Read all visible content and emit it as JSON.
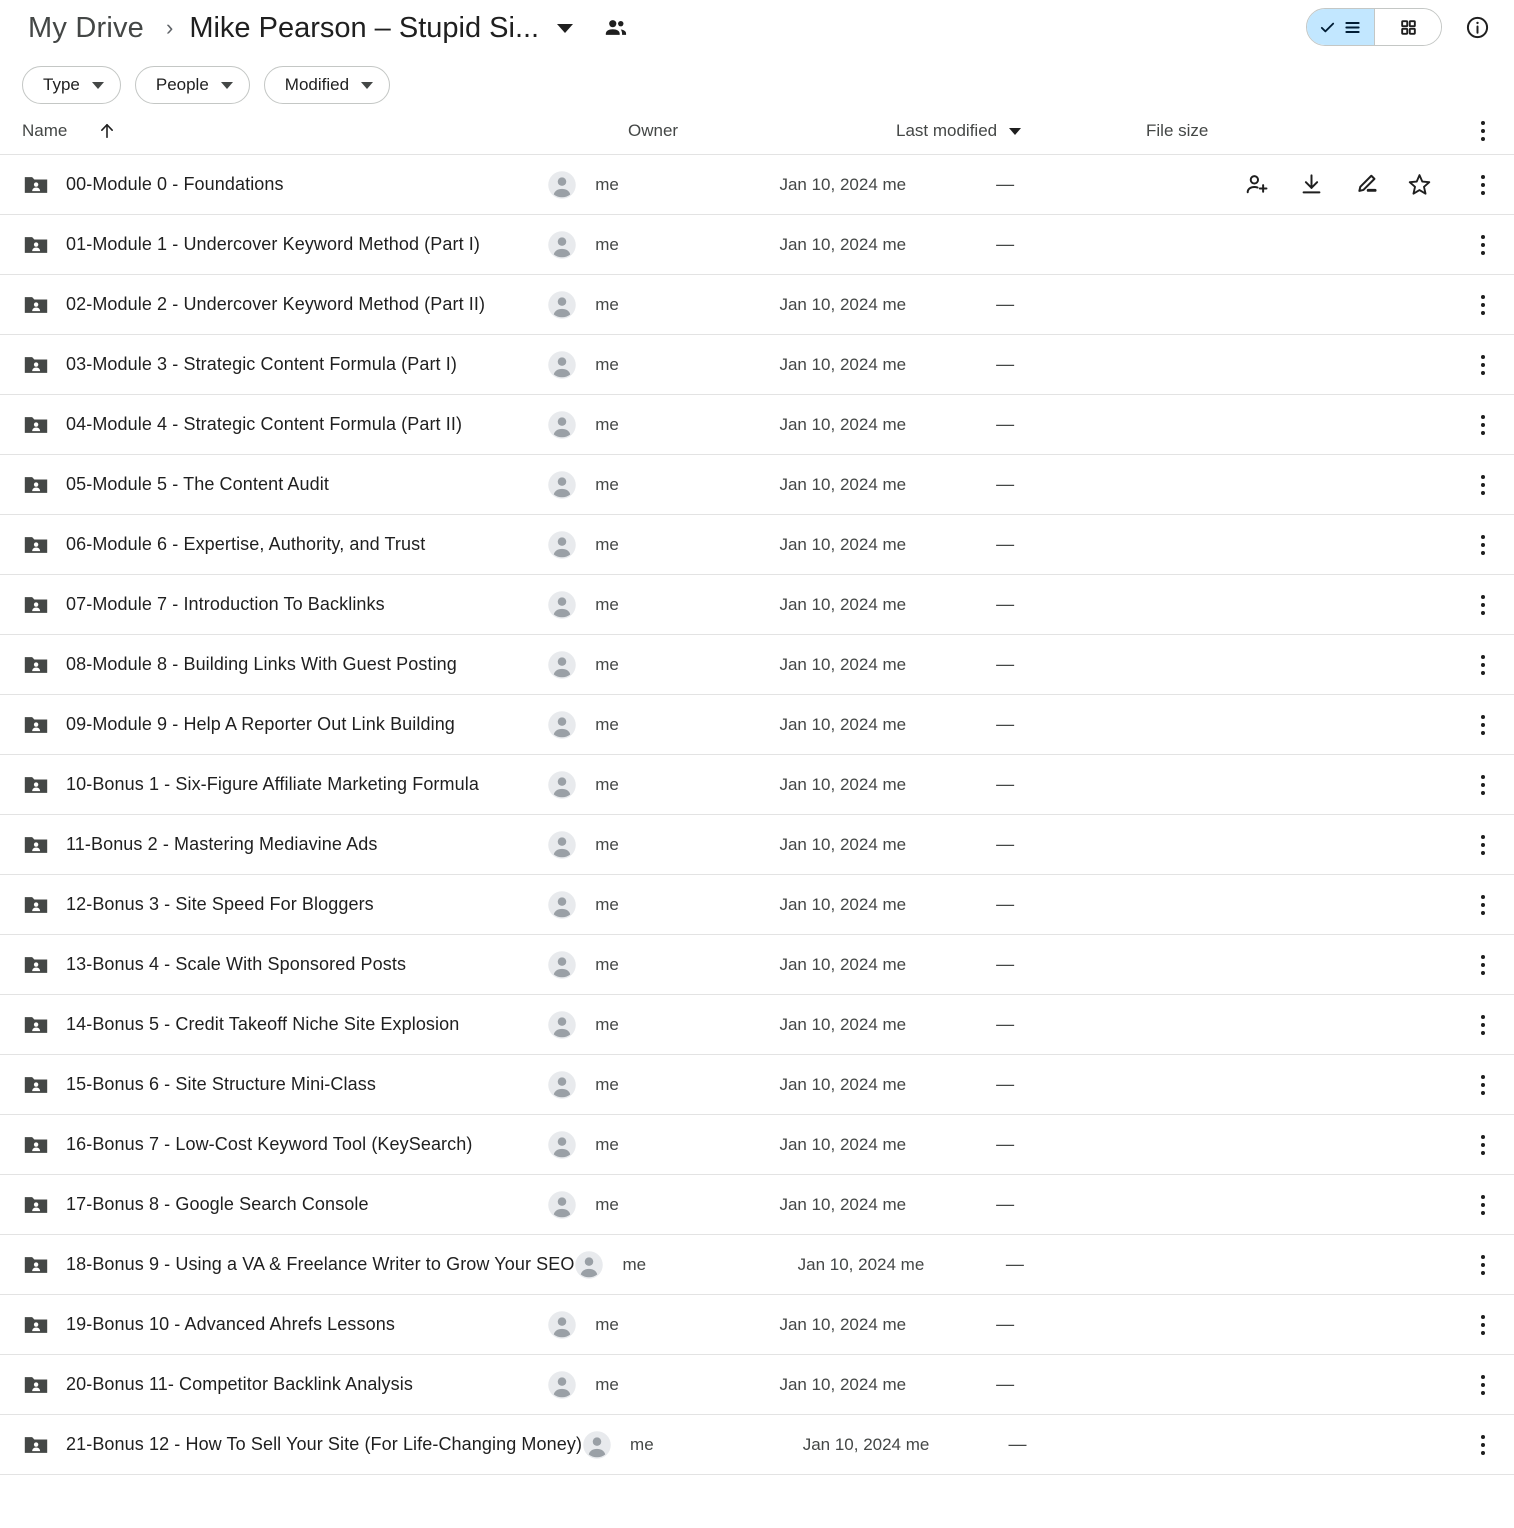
{
  "header": {
    "breadcrumb_root": "My Drive",
    "breadcrumb_separator": "›",
    "breadcrumb_current": "Mike Pearson – Stupid Si...",
    "shared_people_icon": "people-icon",
    "view_list_icon": "list-view-icon",
    "view_grid_icon": "grid-view-icon",
    "info_icon": "info-icon",
    "accent_selected": "#c2e7ff",
    "border_color": "#c4c7c5"
  },
  "filters": [
    {
      "label": "Type",
      "name": "type"
    },
    {
      "label": "People",
      "name": "people"
    },
    {
      "label": "Modified",
      "name": "modified"
    }
  ],
  "columns": {
    "name": "Name",
    "owner": "Owner",
    "last_modified": "Last modified",
    "file_size": "File size",
    "sort_direction_icon": "arrow-up-icon",
    "modified_caret_icon": "caret-down-icon",
    "header_more_icon": "more-options-icon"
  },
  "row_actions": [
    {
      "name": "share",
      "icon": "person-add-icon"
    },
    {
      "name": "download",
      "icon": "download-icon"
    },
    {
      "name": "edit",
      "icon": "pencil-edit-icon"
    },
    {
      "name": "star",
      "icon": "star-icon"
    }
  ],
  "files": [
    {
      "name": "00-Module 0 - Foundations",
      "owner": "me",
      "modified": "Jan 10, 2024 me",
      "size": "—",
      "icon": "shared-folder-icon",
      "show_actions": true
    },
    {
      "name": "01-Module 1 - Undercover Keyword Method (Part I)",
      "owner": "me",
      "modified": "Jan 10, 2024 me",
      "size": "—",
      "icon": "shared-folder-icon",
      "show_actions": false
    },
    {
      "name": "02-Module 2 - Undercover Keyword Method (Part II)",
      "owner": "me",
      "modified": "Jan 10, 2024 me",
      "size": "—",
      "icon": "shared-folder-icon",
      "show_actions": false
    },
    {
      "name": "03-Module 3 - Strategic Content Formula (Part I)",
      "owner": "me",
      "modified": "Jan 10, 2024 me",
      "size": "—",
      "icon": "shared-folder-icon",
      "show_actions": false
    },
    {
      "name": "04-Module 4 - Strategic Content Formula (Part II)",
      "owner": "me",
      "modified": "Jan 10, 2024 me",
      "size": "—",
      "icon": "shared-folder-icon",
      "show_actions": false
    },
    {
      "name": "05-Module 5 - The Content Audit",
      "owner": "me",
      "modified": "Jan 10, 2024 me",
      "size": "—",
      "icon": "shared-folder-icon",
      "show_actions": false
    },
    {
      "name": "06-Module 6 - Expertise, Authority, and Trust",
      "owner": "me",
      "modified": "Jan 10, 2024 me",
      "size": "—",
      "icon": "shared-folder-icon",
      "show_actions": false
    },
    {
      "name": "07-Module 7 - Introduction To Backlinks",
      "owner": "me",
      "modified": "Jan 10, 2024 me",
      "size": "—",
      "icon": "shared-folder-icon",
      "show_actions": false
    },
    {
      "name": "08-Module 8 - Building Links With Guest Posting",
      "owner": "me",
      "modified": "Jan 10, 2024 me",
      "size": "—",
      "icon": "shared-folder-icon",
      "show_actions": false
    },
    {
      "name": "09-Module 9 - Help A Reporter Out Link Building",
      "owner": "me",
      "modified": "Jan 10, 2024 me",
      "size": "—",
      "icon": "shared-folder-icon",
      "show_actions": false
    },
    {
      "name": "10-Bonus 1 - Six-Figure Affiliate Marketing Formula",
      "owner": "me",
      "modified": "Jan 10, 2024 me",
      "size": "—",
      "icon": "shared-folder-icon",
      "show_actions": false
    },
    {
      "name": "11-Bonus 2 - Mastering Mediavine Ads",
      "owner": "me",
      "modified": "Jan 10, 2024 me",
      "size": "—",
      "icon": "shared-folder-icon",
      "show_actions": false
    },
    {
      "name": "12-Bonus 3 - Site Speed For Bloggers",
      "owner": "me",
      "modified": "Jan 10, 2024 me",
      "size": "—",
      "icon": "shared-folder-icon",
      "show_actions": false
    },
    {
      "name": "13-Bonus 4 - Scale With Sponsored Posts",
      "owner": "me",
      "modified": "Jan 10, 2024 me",
      "size": "—",
      "icon": "shared-folder-icon",
      "show_actions": false
    },
    {
      "name": "14-Bonus 5 - Credit Takeoff Niche Site Explosion",
      "owner": "me",
      "modified": "Jan 10, 2024 me",
      "size": "—",
      "icon": "shared-folder-icon",
      "show_actions": false
    },
    {
      "name": "15-Bonus 6 - Site Structure Mini-Class",
      "owner": "me",
      "modified": "Jan 10, 2024 me",
      "size": "—",
      "icon": "shared-folder-icon",
      "show_actions": false
    },
    {
      "name": "16-Bonus 7 - Low-Cost Keyword Tool (KeySearch)",
      "owner": "me",
      "modified": "Jan 10, 2024 me",
      "size": "—",
      "icon": "shared-folder-icon",
      "show_actions": false
    },
    {
      "name": "17-Bonus 8 - Google Search Console",
      "owner": "me",
      "modified": "Jan 10, 2024 me",
      "size": "—",
      "icon": "shared-folder-icon",
      "show_actions": false
    },
    {
      "name": "18-Bonus 9 - Using a VA & Freelance Writer to Grow Your SEO",
      "owner": "me",
      "modified": "Jan 10, 2024 me",
      "size": "—",
      "icon": "shared-folder-icon",
      "show_actions": false
    },
    {
      "name": "19-Bonus 10 - Advanced Ahrefs Lessons",
      "owner": "me",
      "modified": "Jan 10, 2024 me",
      "size": "—",
      "icon": "shared-folder-icon",
      "show_actions": false
    },
    {
      "name": "20-Bonus 11- Competitor Backlink Analysis",
      "owner": "me",
      "modified": "Jan 10, 2024 me",
      "size": "—",
      "icon": "shared-folder-icon",
      "show_actions": false
    },
    {
      "name": "21-Bonus 12 - How To Sell Your Site (For Life-Changing Money)",
      "owner": "me",
      "modified": "Jan 10, 2024 me",
      "size": "—",
      "icon": "shared-folder-icon",
      "show_actions": false
    }
  ]
}
